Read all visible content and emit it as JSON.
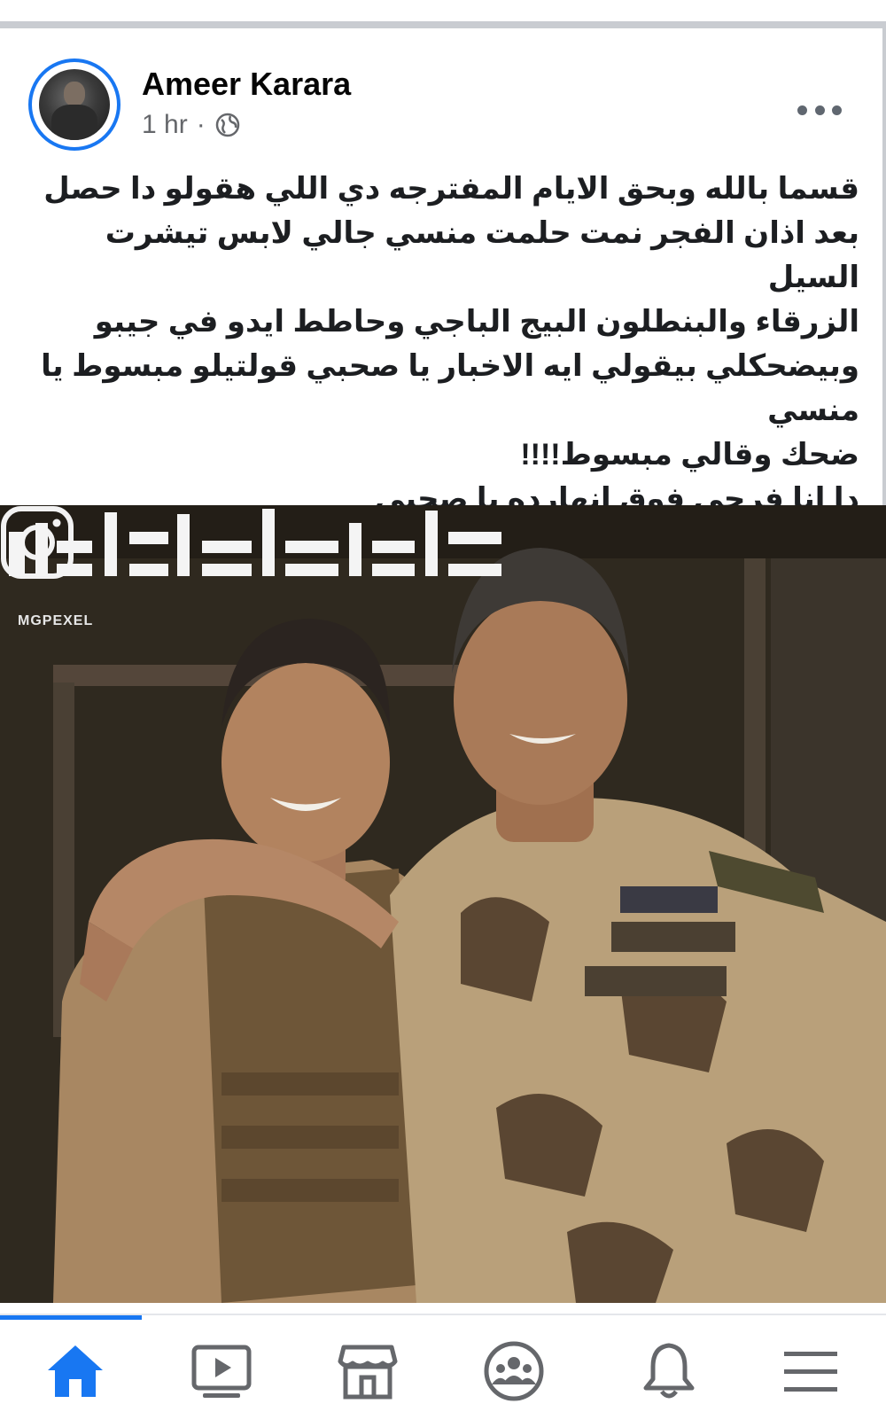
{
  "post": {
    "author": "Ameer Karara",
    "time": "1 hr",
    "separator": "·",
    "privacy_icon": "globe-icon",
    "more_icon": "more-options-icon",
    "text_lines": [
      "قسما بالله  وبحق الايام المفترجه دي اللي هقولو دا حصل",
      "بعد اذان الفجر نمت حلمت منسي جالي لابس تيشرت السيل",
      "الزرقاء والبنطلون البيج الباجي وحاطط ايدو في جيبو",
      "وبيضحكلي بيقولي ايه الاخبار يا صحبي قولتيلو مبسوط يا",
      "منسي",
      "ضحك وقالي مبسوط!!!!",
      "دا انا فرحي فوق انهارده يا صحبي"
    ]
  },
  "photo": {
    "watermark": "MGPEXEL",
    "watermark_icon": "instagram-icon"
  },
  "bottom_nav": {
    "items": [
      {
        "icon": "home-icon",
        "active": true
      },
      {
        "icon": "video-icon",
        "active": false
      },
      {
        "icon": "marketplace-icon",
        "active": false
      },
      {
        "icon": "groups-icon",
        "active": false
      },
      {
        "icon": "bell-icon",
        "active": false
      },
      {
        "icon": "menu-icon",
        "active": false
      }
    ],
    "active_color": "#1877f2",
    "inactive_color": "#65676b"
  }
}
